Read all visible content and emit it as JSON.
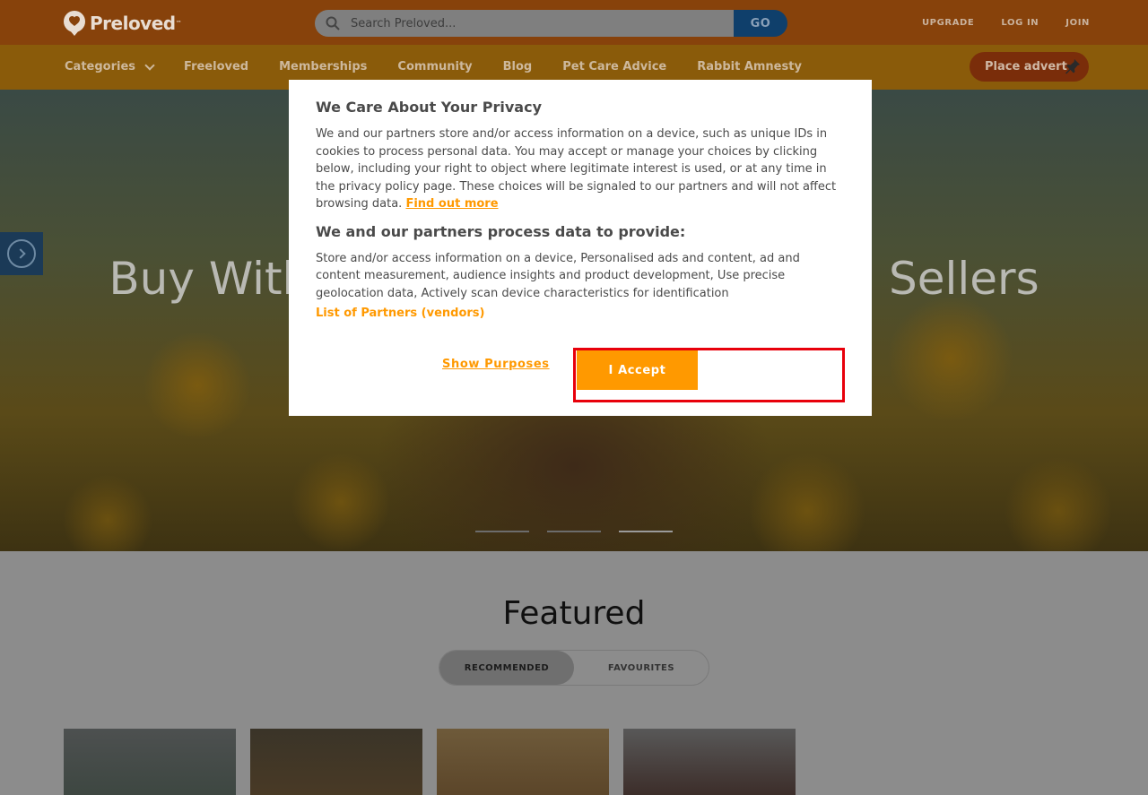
{
  "header": {
    "logo_text": "Preloved",
    "logo_tm": "™",
    "search_placeholder": "Search Preloved...",
    "search_button": "GO",
    "links": [
      "UPGRADE",
      "LOG IN",
      "JOIN"
    ]
  },
  "nav": {
    "items": [
      "Categories",
      "Freeloved",
      "Memberships",
      "Community",
      "Blog",
      "Pet Care Advice",
      "Rabbit Amnesty"
    ],
    "place_advert": "Place advert"
  },
  "hero": {
    "title": "Buy With Confidence from Trusted Sellers",
    "slides": 3,
    "active_slide": 3
  },
  "featured": {
    "title": "Featured",
    "tabs": [
      "RECOMMENDED",
      "FAVOURITES"
    ],
    "active_tab": "RECOMMENDED"
  },
  "modal": {
    "title": "We Care About Your Privacy",
    "body": "We and our partners store and/or access information on a device, such as unique IDs in cookies to process personal data. You may accept or manage your choices by clicking below, including your right to object where legitimate interest is used, or at any time in the privacy policy page. These choices will be signaled to our partners and will not affect browsing data.",
    "find_out_more": "Find out more",
    "subtitle": "We and our partners process data to provide:",
    "purposes": "Store and/or access information on a device, Personalised ads and content, ad and content measurement, audience insights and product development, Use precise geolocation data, Actively scan device characteristics for identification",
    "partners_link": "List of Partners (vendors)",
    "show_purposes": "Show Purposes",
    "accept": "I Accept"
  },
  "colors": {
    "brand_orange": "#ff9900",
    "highlight_red": "#e8000b",
    "go_blue": "#0f3f6b"
  }
}
